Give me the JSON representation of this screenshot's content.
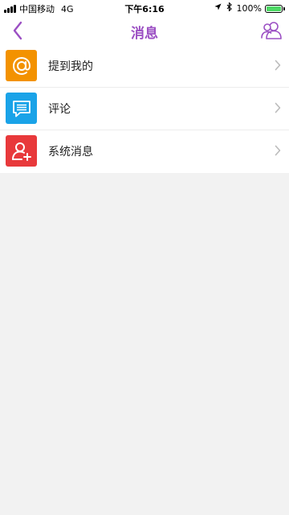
{
  "status_bar": {
    "carrier": "中国移动",
    "network": "4G",
    "time": "下午6:16",
    "battery": "100%",
    "battery_level": 1.0,
    "icons": [
      "location-arrow-icon",
      "bluetooth-icon",
      "battery-icon"
    ]
  },
  "nav": {
    "title": "消息",
    "back_icon": "chevron-left-icon",
    "right_icon": "contacts-icon"
  },
  "menu_items": [
    {
      "label": "提到我的",
      "icon": "at-sign-icon",
      "color": "#f39200"
    },
    {
      "label": "评论",
      "icon": "comment-icon",
      "color": "#1aa3e8"
    },
    {
      "label": "系统消息",
      "icon": "add-user-icon",
      "color": "#e8393b"
    }
  ],
  "colors": {
    "accent": "#9b4fc3",
    "background": "#f2f2f2"
  }
}
